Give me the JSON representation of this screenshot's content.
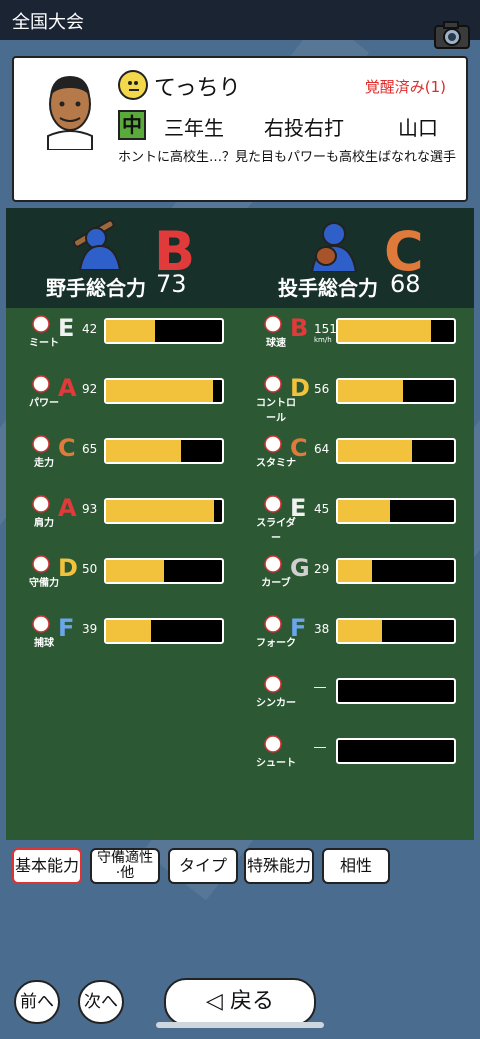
{
  "header": {
    "title": "全国大会"
  },
  "player": {
    "name": "てっちり",
    "awakened": "覚醒済み(1)",
    "position": "中",
    "grade": "三年生",
    "handedness": "右投右打",
    "hometown": "山口",
    "description": "ホントに高校生…？見た目もパワーも高校生ばなれな選手"
  },
  "fielder": {
    "rank": "B",
    "label": "野手総合力",
    "total": "73",
    "stats": [
      {
        "label": "ミート",
        "grade": "E",
        "value": "42",
        "level": 0.42,
        "color": "#f1f1f1"
      },
      {
        "label": "パワー",
        "grade": "A",
        "value": "92",
        "level": 0.92,
        "color": "#e03a3a"
      },
      {
        "label": "走力",
        "grade": "C",
        "value": "65",
        "level": 0.65,
        "color": "#e07a3a"
      },
      {
        "label": "肩力",
        "grade": "A",
        "value": "93",
        "level": 0.93,
        "color": "#e03a3a"
      },
      {
        "label": "守備力",
        "grade": "D",
        "value": "50",
        "level": 0.5,
        "color": "#f3c23d"
      },
      {
        "label": "捕球",
        "grade": "F",
        "value": "39",
        "level": 0.39,
        "color": "#6aa6ee"
      }
    ]
  },
  "pitcher": {
    "rank": "C",
    "label": "投手総合力",
    "total": "68",
    "stats": [
      {
        "label": "球速",
        "grade": "B",
        "value": "151",
        "unit": "km/h",
        "level": 0.8,
        "color": "#e03a3a"
      },
      {
        "label": "コントロール",
        "grade": "D",
        "value": "56",
        "level": 0.56,
        "color": "#f3c23d"
      },
      {
        "label": "スタミナ",
        "grade": "C",
        "value": "64",
        "level": 0.64,
        "color": "#e07a3a"
      },
      {
        "label": "スライダー",
        "grade": "E",
        "value": "45",
        "level": 0.45,
        "color": "#f1f1f1"
      },
      {
        "label": "カーブ",
        "grade": "G",
        "value": "29",
        "level": 0.29,
        "color": "#cfcfcf"
      },
      {
        "label": "フォーク",
        "grade": "F",
        "value": "38",
        "level": 0.38,
        "color": "#6aa6ee"
      },
      {
        "label": "シンカー",
        "grade": "",
        "value": "―",
        "level": 0,
        "color": "#ffffff"
      },
      {
        "label": "シュート",
        "grade": "",
        "value": "―",
        "level": 0,
        "color": "#ffffff"
      }
    ]
  },
  "tabs": [
    {
      "label": "基本能力",
      "active": true
    },
    {
      "label": "守備適性・他",
      "line1": "守備適性",
      "line2": "·他"
    },
    {
      "label": "タイプ"
    },
    {
      "label": "特殊能力"
    },
    {
      "label": "相性"
    }
  ],
  "nav": {
    "prev": "前へ",
    "next": "次へ",
    "back": "◁ 戻る"
  },
  "colors": {
    "rank_b": "#e03a3a",
    "rank_c": "#e07a3a",
    "bar_fill": "#f3c23d",
    "board": "#2c5934"
  }
}
